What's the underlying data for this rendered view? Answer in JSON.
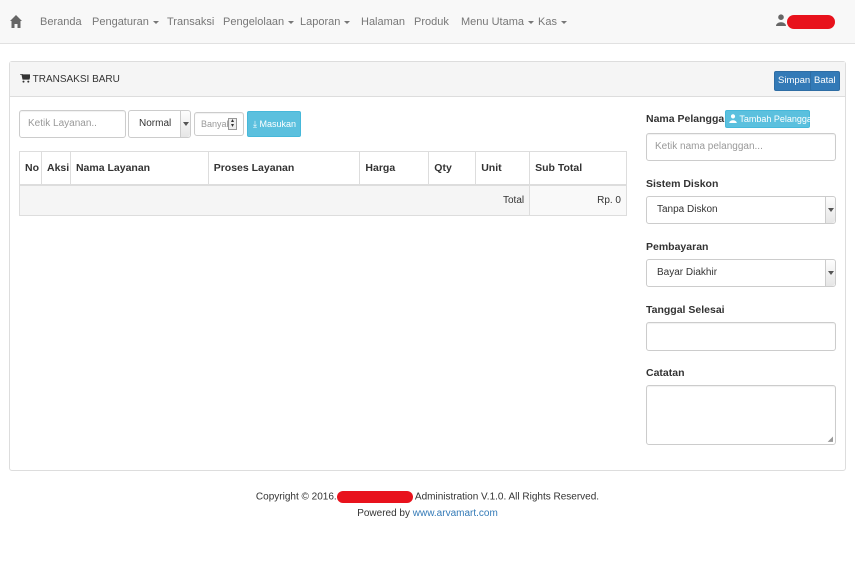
{
  "navbar": {
    "home_icon": "home-icon",
    "items": [
      {
        "label": "Beranda",
        "dropdown": false
      },
      {
        "label": "Pengaturan",
        "dropdown": true
      },
      {
        "label": "Transaksi",
        "dropdown": false
      },
      {
        "label": "Pengelolaan",
        "dropdown": true
      },
      {
        "label": "Laporan",
        "dropdown": true
      },
      {
        "label": "Halaman",
        "dropdown": false
      },
      {
        "label": "Produk",
        "dropdown": false
      },
      {
        "label": "Menu Utama",
        "dropdown": true
      },
      {
        "label": "Kas",
        "dropdown": true
      }
    ],
    "user_icon": "user-icon"
  },
  "panel": {
    "title": "TRANSAKSI BARU",
    "title_icon": "cart-icon",
    "save_label": "Simpan",
    "cancel_label": "Batal"
  },
  "service_form": {
    "service_placeholder": "Ketik Layanan..",
    "type_value": "Normal",
    "qty_placeholder": "Banyak",
    "add_label": "Masukan"
  },
  "table": {
    "headers": [
      "No",
      "Aksi",
      "Nama Layanan",
      "Proses Layanan",
      "Harga",
      "Qty",
      "Unit",
      "Sub Total"
    ],
    "total_label": "Total",
    "total_value": "Rp. 0"
  },
  "customer": {
    "label": "Nama Pelanggan |",
    "add_label": "Tambah Pelanggan",
    "placeholder": "Ketik nama pelanggan..."
  },
  "discount": {
    "label": "Sistem Diskon",
    "value": "Tanpa Diskon"
  },
  "payment": {
    "label": "Pembayaran",
    "value": "Bayar Diakhir"
  },
  "finish_date": {
    "label": "Tanggal Selesai",
    "value": ""
  },
  "notes": {
    "label": "Catatan",
    "value": ""
  },
  "footer": {
    "copyright_prefix": "Copyright © 2016.",
    "copyright_suffix": "Administration V.1.0. All Rights Reserved.",
    "powered_prefix": "Powered by",
    "powered_link": "www.arvamart.com"
  },
  "colors": {
    "primary": "#337ab7",
    "info": "#5bc0de",
    "redaction": "#e8121c"
  }
}
